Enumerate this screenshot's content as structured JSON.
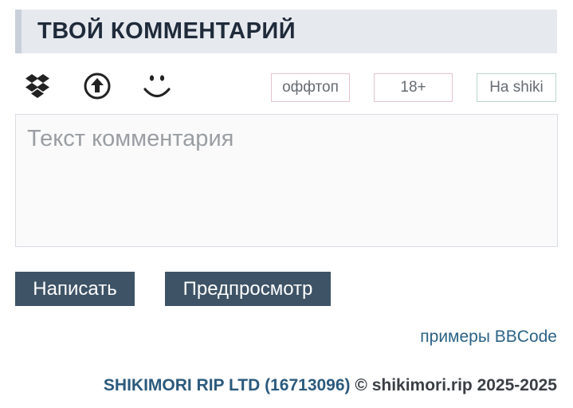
{
  "header": {
    "title": "ТВОЙ КОММЕНТАРИЙ"
  },
  "toolbar": {
    "icons": [
      "dropbox-icon",
      "upload-icon",
      "smiley-icon"
    ],
    "tags": {
      "offtopic": "оффтоп",
      "adult": "18+",
      "shiki": "На shiki"
    }
  },
  "comment": {
    "placeholder": "Текст комментария",
    "value": ""
  },
  "actions": {
    "submit_label": "Написать",
    "preview_label": "Предпросмотр"
  },
  "links": {
    "bbcode_examples": "примеры BBCode"
  },
  "footer": {
    "company": "SHIKIMORI RIP LTD (16713096)",
    "copyright": "© shikimori.rip 2025-2025"
  },
  "colors": {
    "header_bg": "#e6e9ee",
    "button_bg": "#3e5366",
    "link": "#2b6286"
  }
}
